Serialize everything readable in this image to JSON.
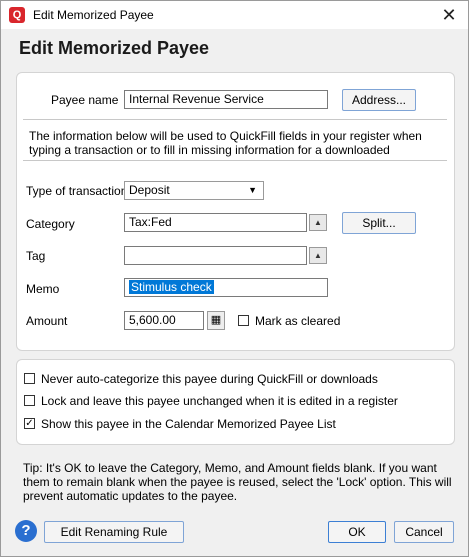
{
  "window": {
    "title": "Edit Memorized Payee",
    "app_icon": "Q"
  },
  "heading": "Edit Memorized Payee",
  "payee": {
    "label": "Payee name",
    "value": "Internal Revenue Service",
    "address_button": "Address..."
  },
  "info_text": "The information below will be used to QuickFill fields in your register when typing a transaction or to fill in missing information for a downloaded",
  "transaction_type": {
    "label": "Type of transaction",
    "value": "Deposit"
  },
  "category": {
    "label": "Category",
    "value": "Tax:Fed",
    "split_button": "Split..."
  },
  "tag": {
    "label": "Tag",
    "value": ""
  },
  "memo": {
    "label": "Memo",
    "value": "Stimulus check"
  },
  "amount": {
    "label": "Amount",
    "value": "5,600.00",
    "mark_cleared_label": "Mark as cleared",
    "mark_cleared": false
  },
  "options": [
    {
      "label": "Never auto-categorize this payee during QuickFill or downloads",
      "checked": false
    },
    {
      "label": "Lock and leave this payee unchanged when it is edited in a register",
      "checked": false
    },
    {
      "label": "Show this payee in the Calendar Memorized Payee List",
      "checked": true
    }
  ],
  "tip": "Tip: It's OK to leave the Category, Memo, and Amount fields blank. If you want them to remain blank when the payee is reused, select the 'Lock' option. This will prevent automatic updates to the payee.",
  "footer": {
    "help": "?",
    "rename_button": "Edit Renaming Rule",
    "ok_button": "OK",
    "cancel_button": "Cancel"
  }
}
